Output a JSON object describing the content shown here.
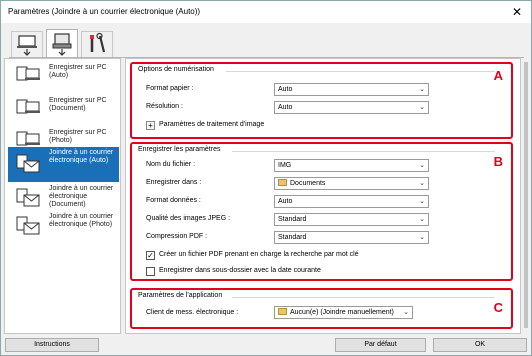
{
  "window": {
    "title": "Paramètres (Joindre à un courrier électronique (Auto))",
    "close_glyph": "✕"
  },
  "top_tabs": [
    {
      "icon": "scan-from-computer-icon"
    },
    {
      "icon": "scan-from-operation-panel-icon"
    },
    {
      "icon": "general-settings-tools-icon"
    }
  ],
  "sidebar": {
    "items": [
      {
        "label": "Enregistrer sur PC (Auto)",
        "icon": "save-pc-icon"
      },
      {
        "label": "Enregistrer sur PC (Document)",
        "icon": "save-pc-icon"
      },
      {
        "label": "Enregistrer sur PC (Photo)",
        "icon": "save-pc-icon"
      },
      {
        "label": "Joindre à un courrier électronique (Auto)",
        "icon": "email-icon"
      },
      {
        "label": "Joindre à un courrier électronique (Document)",
        "icon": "email-icon"
      },
      {
        "label": "Joindre à un courrier électronique (Photo)",
        "icon": "email-icon"
      }
    ]
  },
  "scan_options": {
    "title": "Options de numérisation",
    "letter": "A",
    "paper_size_label": "Format papier :",
    "paper_size_value": "Auto",
    "resolution_label": "Résolution :",
    "resolution_value": "Auto",
    "image_processing_label": "Paramètres de traitement d'image"
  },
  "save_settings": {
    "title": "Enregistrer les paramètres",
    "letter": "B",
    "file_name_label": "Nom du fichier :",
    "file_name_value": "IMG",
    "save_in_label": "Enregistrer dans :",
    "save_in_value": "Documents",
    "data_format_label": "Format données :",
    "data_format_value": "Auto",
    "jpeg_quality_label": "Qualité des images JPEG :",
    "jpeg_quality_value": "Standard",
    "pdf_compression_label": "Compression PDF :",
    "pdf_compression_value": "Standard",
    "keyword_pdf_label": "Créer un fichier PDF prenant en charge la recherche par mot clé",
    "keyword_pdf_checked": true,
    "subfolder_label": "Enregistrer dans sous-dossier avec la date courante",
    "subfolder_checked": false
  },
  "app_settings": {
    "title": "Paramètres de l'application",
    "letter": "C",
    "email_client_label": "Client de mess. électronique :",
    "email_client_value": "Aucun(e) (Joindre manuellement)"
  },
  "footer": {
    "instructions_label": "Instructions",
    "defaults_label": "Par défaut",
    "ok_label": "OK"
  },
  "colors": {
    "accent_red": "#e3001b",
    "selection_blue": "#1a70b8"
  }
}
